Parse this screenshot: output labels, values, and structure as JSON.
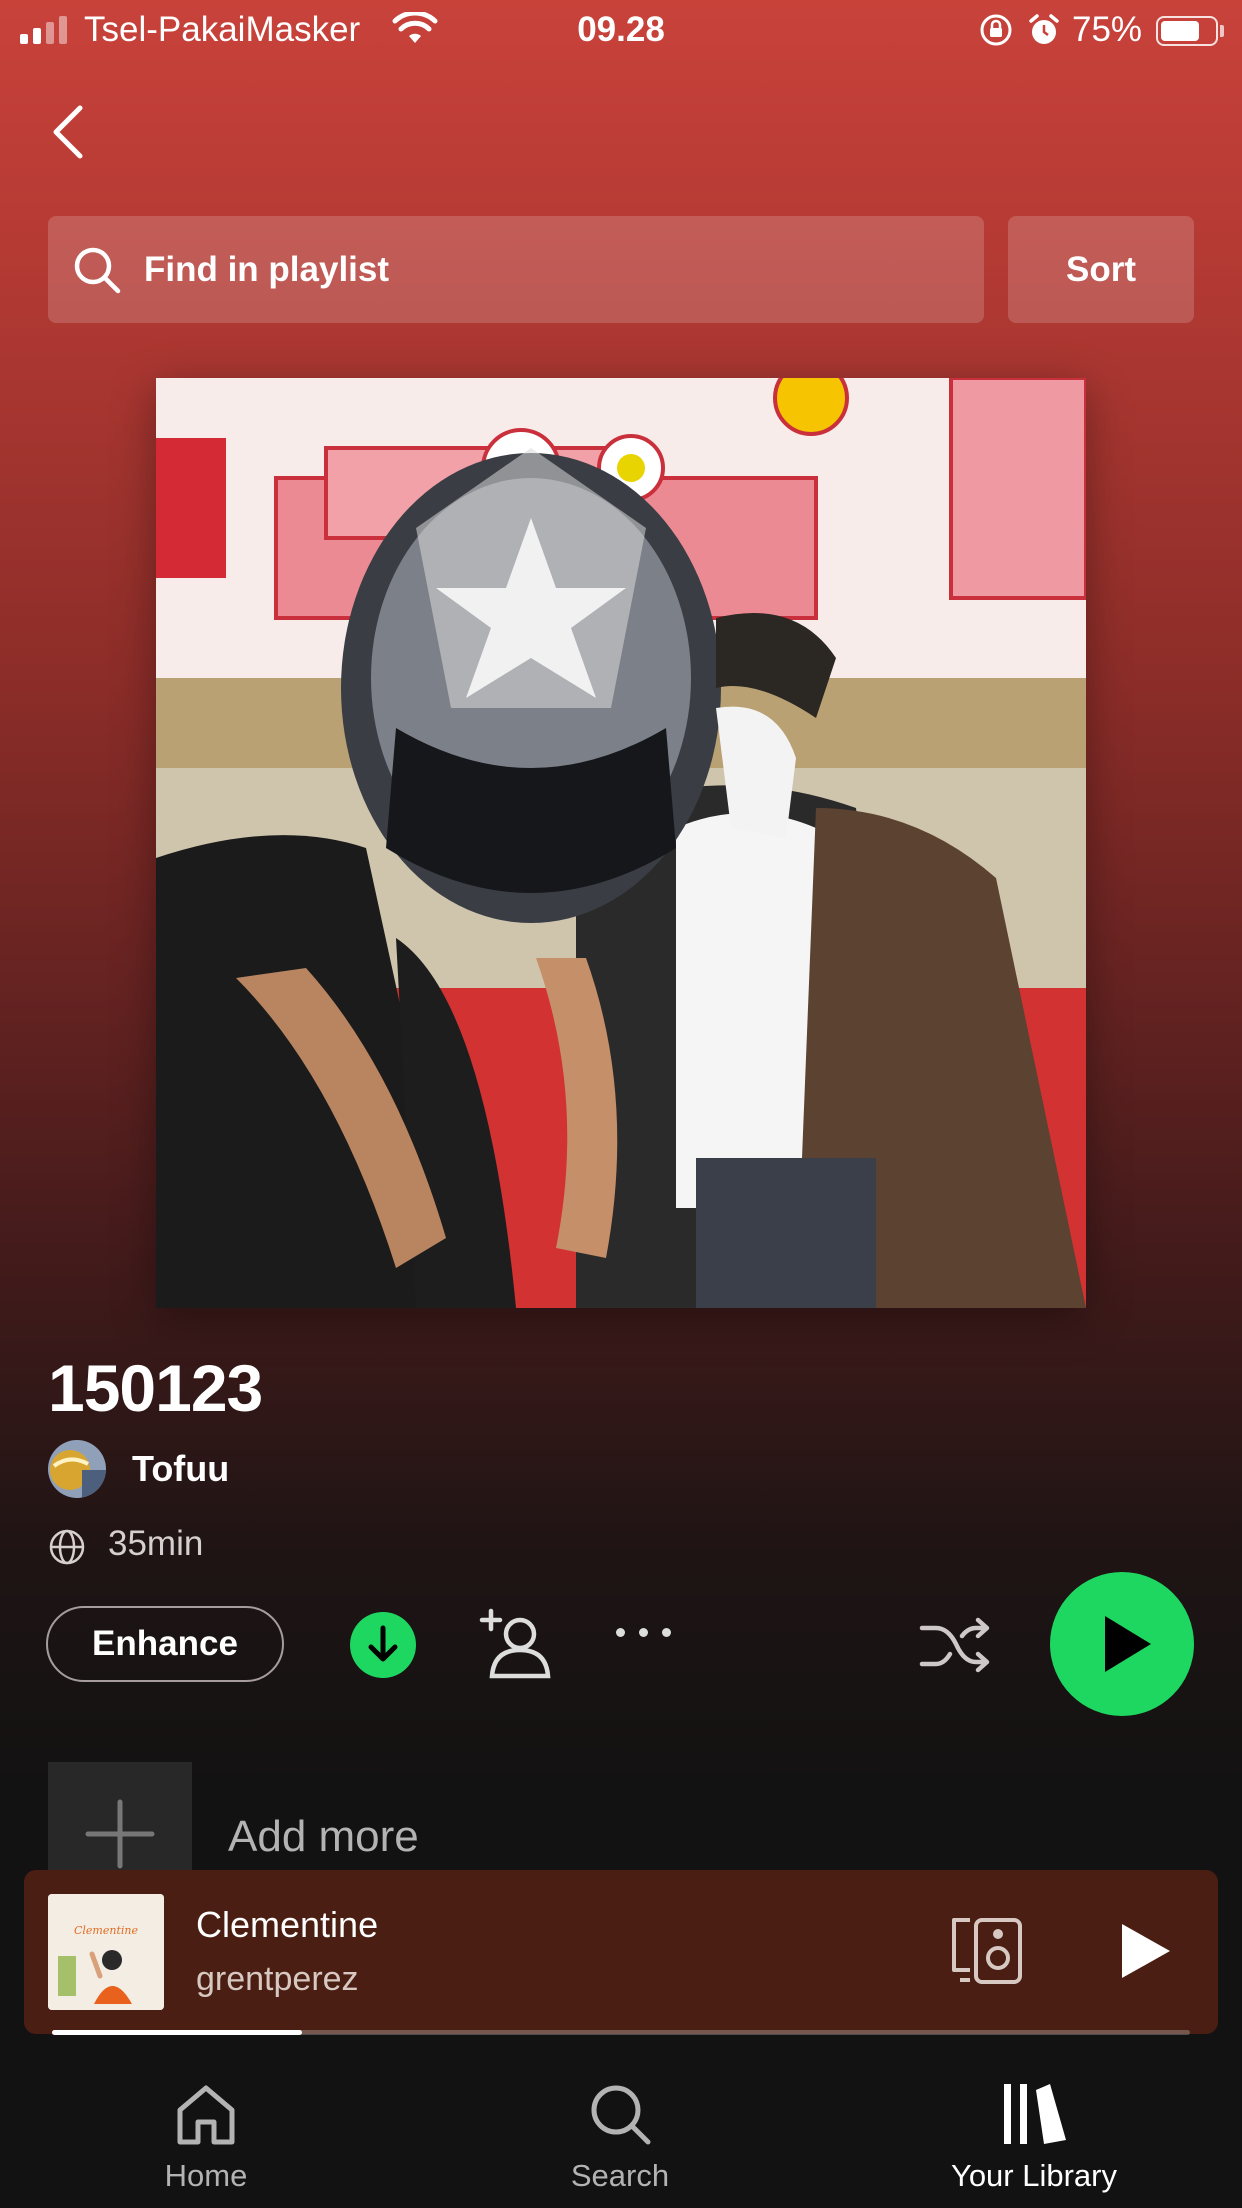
{
  "status_bar": {
    "carrier": "Tsel-PakaiMasker",
    "time": "09.28",
    "battery": "75%",
    "battery_level": 0.75
  },
  "header": {
    "back_icon": "chevron-left-icon",
    "search_placeholder": "Find in playlist",
    "sort_label": "Sort"
  },
  "playlist": {
    "title": "150123",
    "owner": "Tofuu",
    "duration": "35min"
  },
  "actions": {
    "enhance_label": "Enhance",
    "download_icon": "download-icon",
    "add_user_icon": "add-user-icon",
    "more_icon": "more-icon",
    "shuffle_icon": "shuffle-icon",
    "play_icon": "play-icon"
  },
  "add_more": {
    "label": "Add more"
  },
  "now_playing": {
    "song": "Clementine",
    "artist": "grentperez",
    "art_text": "Clementine",
    "progress": 0.22
  },
  "nav": {
    "items": [
      {
        "label": "Home",
        "icon": "home-icon"
      },
      {
        "label": "Search",
        "icon": "search-icon"
      },
      {
        "label": "Your Library",
        "icon": "library-icon"
      }
    ]
  },
  "colors": {
    "accent": "#1ed760",
    "header_red": "#c8423a",
    "mini_player": "#4a1e12",
    "background": "#121212"
  }
}
